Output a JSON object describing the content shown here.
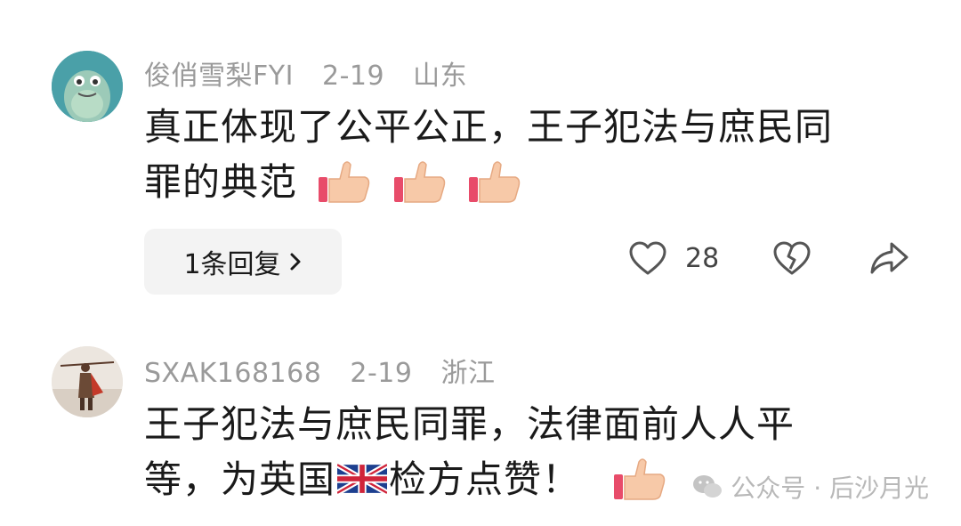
{
  "comments": [
    {
      "username": "俊俏雪梨FYI",
      "date": "2-19",
      "location": "山东",
      "text_line1": "真正体现了公平公正，王子犯法与庶民同",
      "text_line2": "罪的典范",
      "reply_label": "1条回复",
      "like_count": "28",
      "avatar_icon": "frog-avatar",
      "emoji": "thumbs-up-icon"
    },
    {
      "username": "SXAK168168",
      "date": "2-19",
      "location": "浙江",
      "text_line1": "王子犯法与庶民同罪，法律面前人人平",
      "text_line2a": "等，为英国",
      "text_line2b": "检方点赞！",
      "avatar_icon": "warrior-avatar",
      "emoji": "thumbs-up-icon",
      "flag": "uk-flag-icon"
    }
  ],
  "watermark": {
    "text": "公众号 · 后沙月光"
  },
  "colors": {
    "meta_text": "#9a9a9a",
    "body_text": "#1a1a1a",
    "reply_bg": "#f3f3f3"
  }
}
